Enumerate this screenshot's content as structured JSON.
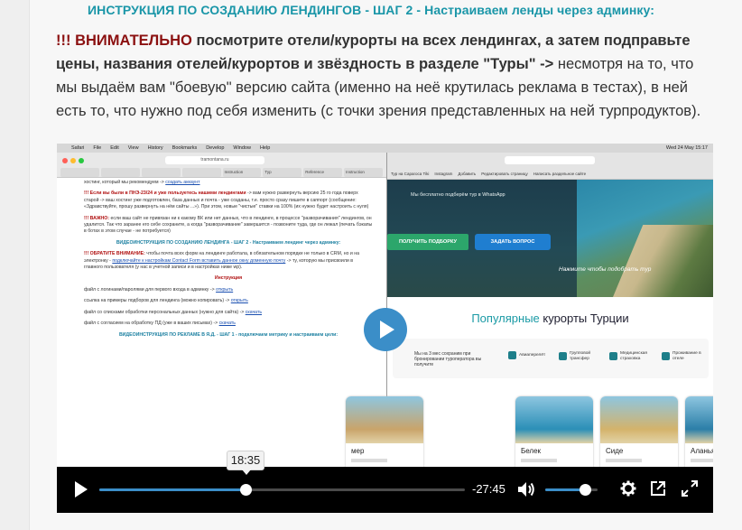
{
  "heading": "ИНСТРУКЦИЯ ПО СОЗДАНИЮ ЛЕНДИНГОВ - ШАГ 2 - Настраиваем ленды через админку:",
  "intro": {
    "warn": "!!! ВНИМАТЕЛЬНО",
    "bold": " посмотрите отели/курорты на всех лендингах, а затем подправьте цены, названия отелей/курортов и звёздность в разделе \"Туры\" ->",
    "rest": " несмотря на то, что мы выдаём вам \"боевую\" версию сайта (именно на неё крутилась реклама в тестах), в ней есть то, что нужно под себя изменить (с точки зрения представленных на ней турпродуктов)."
  },
  "video": {
    "menubar": {
      "items": [
        "Safari",
        "File",
        "Edit",
        "View",
        "History",
        "Bookmarks",
        "Develop",
        "Window",
        "Help"
      ],
      "clock": "Wed 24 May  15:17"
    },
    "left_window": {
      "url": "tramontana.ru",
      "tabs": [
        "",
        "",
        "",
        "",
        "Instruction",
        "Тур",
        "Reference",
        "Instruction"
      ],
      "doc": {
        "p1_link": "создать аккаунт",
        "p1": "хостинг, который мы рекомендуем ->",
        "p2_red": "!!! Если вы были в ПНЭ-23/24 и уже пользуетесь нашими лендингами",
        "p2": " -> вам нужно развернуть версию 25 го года поверх старой -> ваш хостинг уже подготовлен, база данных и почта - уже созданы, т.е. просто сразу пишите в саппорт (сообщение: «Здравствуйте, прошу развернуть на нём сайты ...»). При этом, новые \"чистые\" ставки на 100% (их нужно будет настроить с нуля)",
        "p3_red": "!!! ВАЖНО:",
        "p3": " если ваш сайт не привязан ни к какому ВК или нет данных, что в лендинге, в процессе \"разворачивания\" лендингов, он удалится. Так что заранее его себе сохраните, а когда \"разворачивание\" завершится - позвоните туда, где он лежал (печать бэкапы в ботах в этом случае - не потребуется)",
        "video_title": "ВИДЕОИНСТРУКЦИЯ ПО СОЗДАНИЮ ЛЕНДИНГА - ШАГ 2 - Настраиваем лендинг через админку:",
        "p4_red": "!!! ОБРАТИТЕ ВНИМАНИЕ:",
        "p4": " чтобы почта всех форм на лендинге работала, в обязательном порядке не только в CRM, но и на электронку -",
        "p4_link": "подключайте к настройкам Contact Form вставить данное окну доменную почту",
        "p4_tail": " -> ту, которую мы присвоили в главного пользователя (у нас в учетной записи и в настройках ниже wp).",
        "instr": "Инструкция",
        "i1": "файл с логинами/паролями для первого входа в админку ->",
        "i1_link": "открыть",
        "i2": "ссылка на примеры подборов для лендинга (можно копировать) ->",
        "i2_link": "открыть",
        "i3": "файл со списками обработки персональных данных (нужно для сайта) ->",
        "i3_link": "скачать",
        "i4": "файл с согласием на обработку ПД (уже в ваших письмах) ->",
        "i4_link": "скачать",
        "ads_title": "ВИДЕОИНСТРУКЦИЯ ПО РЕКЛАМЕ В Я.Д. - ШАГ 1 - подключаем метрику и настраиваем цели:"
      }
    },
    "right_window": {
      "url": "",
      "bookmarks": [
        "Тур на Сарагоса Tiki",
        "Instagram",
        "Добавить",
        "Редактировать страницу",
        "Написать раздельное сайте"
      ],
      "hero_text": "Мы бесплатно подберём тур в WhatsApp",
      "btn_pickup": "ПОЛУЧИТЬ ПОДБОРКУ",
      "btn_question": "ЗАДАТЬ ВОПРОС",
      "hand_note": "Нажмите чтобы подобрать тур",
      "popular_hl": "Популярные",
      "popular_rest": " курорты Турции",
      "features_lead": "Мы на 3 мес сохраним при бронировании туроператора вы получите",
      "features": [
        "Авиаперелёт",
        "Групповой трансфер",
        "Медицинская страховка",
        "Проживание в отеле"
      ],
      "cards": [
        {
          "name": "мер",
          "color": "#c9a46a"
        },
        {
          "name": "Белек",
          "color": "#2b8fb7"
        },
        {
          "name": "Сиде",
          "color": "#d4b36b"
        },
        {
          "name": "Аланья",
          "color": "#2b7ea8"
        }
      ]
    },
    "player": {
      "current_time": "18:35",
      "remaining": "-27:45",
      "progress": 0.4,
      "volume": 0.75,
      "accent": "#3b8ec8"
    }
  }
}
